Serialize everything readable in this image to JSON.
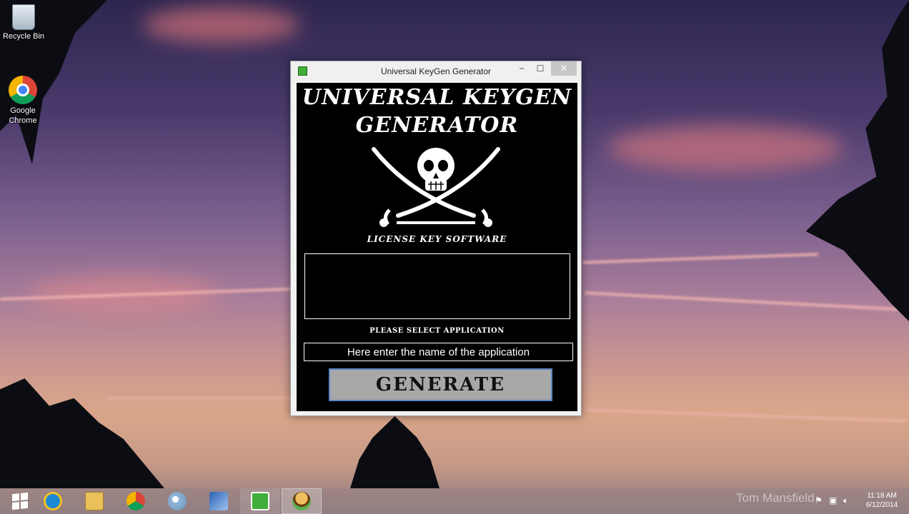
{
  "desktop": {
    "icons": [
      {
        "label": "Recycle Bin"
      },
      {
        "label": "Google Chrome"
      }
    ]
  },
  "window": {
    "title": "Universal KeyGen Generator",
    "controls": {
      "minimize": "−",
      "maximize": "☐",
      "close": "✕"
    }
  },
  "app": {
    "heading_line1": "UNIVERSAL KEYGEN",
    "heading_line2": "GENERATOR",
    "subtitle": "LICENSE KEY SOFTWARE",
    "output_text": "",
    "select_label": "PLEASE SELECT APPLICATION",
    "app_name_value": "Here enter the name of the application",
    "generate_label": "GENERATE"
  },
  "taskbar": {
    "items": [
      {
        "icon": "windows-start-icon"
      },
      {
        "icon": "internet-explorer-icon"
      },
      {
        "icon": "file-explorer-icon"
      },
      {
        "icon": "chrome-icon"
      },
      {
        "icon": "paint-icon"
      },
      {
        "icon": "network-icon"
      },
      {
        "icon": "keygen-app-icon"
      },
      {
        "icon": "burger-app-icon"
      }
    ],
    "watermark": "Tom Mansfield",
    "clock": {
      "time": "11:18 AM",
      "date": "6/12/2014"
    }
  },
  "colors": {
    "window_content_bg": "#000000",
    "generate_bg": "#a8a8a8",
    "generate_border": "#5b86c8"
  }
}
